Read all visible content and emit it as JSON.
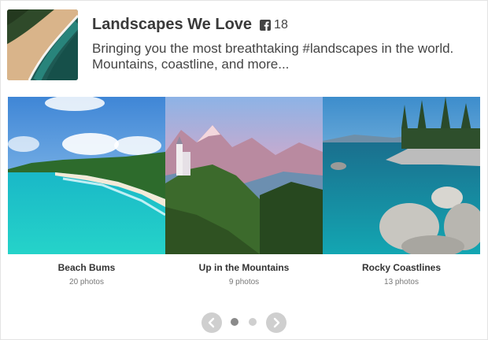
{
  "album": {
    "title": "Landscapes We Love",
    "count": "18",
    "description": "Bringing you the most breathtaking #landscapes in the world. Mountains, coastline, and more..."
  },
  "galleries": [
    {
      "title": "Beach Bums",
      "count": "20 photos"
    },
    {
      "title": "Up in the Mountains",
      "count": "9 photos"
    },
    {
      "title": "Rocky Coastlines",
      "count": "13 photos"
    }
  ],
  "pager": {
    "pages": 2,
    "current": 1
  },
  "icons": {
    "album": "facebook-icon",
    "prev": "chevron-left-icon",
    "next": "chevron-right-icon"
  },
  "colors": {
    "title": "#3a3a3a",
    "text": "#444444",
    "dot_active": "#8a8a8a",
    "dot_inactive": "#cfcfcf"
  }
}
